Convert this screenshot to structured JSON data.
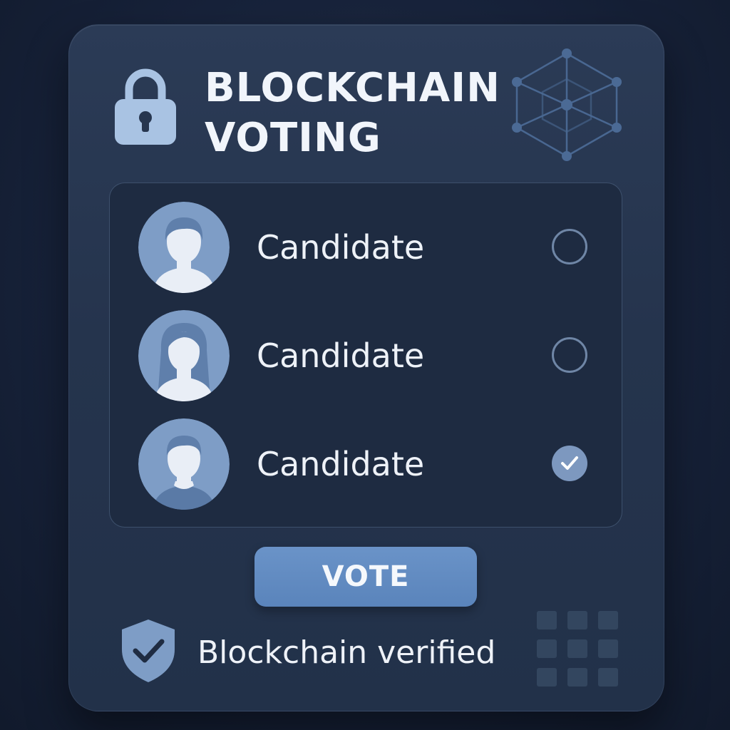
{
  "header": {
    "title_line1": "BLOCKCHAIN",
    "title_line2": "VOTING",
    "lock_icon": "lock-icon",
    "network_icon": "blockchain-cube-icon"
  },
  "candidates": [
    {
      "label": "Candidate",
      "avatar": "male-avatar",
      "selected": false
    },
    {
      "label": "Candidate",
      "avatar": "female-avatar",
      "selected": false
    },
    {
      "label": "Candidate",
      "avatar": "male-avatar",
      "selected": true
    }
  ],
  "vote_button": {
    "label": "VOTE"
  },
  "footer": {
    "verified_text": "Blockchain verified",
    "shield_icon": "shield-check-icon",
    "grid_icon": "grid-icon"
  },
  "colors": {
    "background": "#17223a",
    "card": "#27364f",
    "accent": "#6a93c8",
    "icon_light": "#a9c3e3"
  }
}
